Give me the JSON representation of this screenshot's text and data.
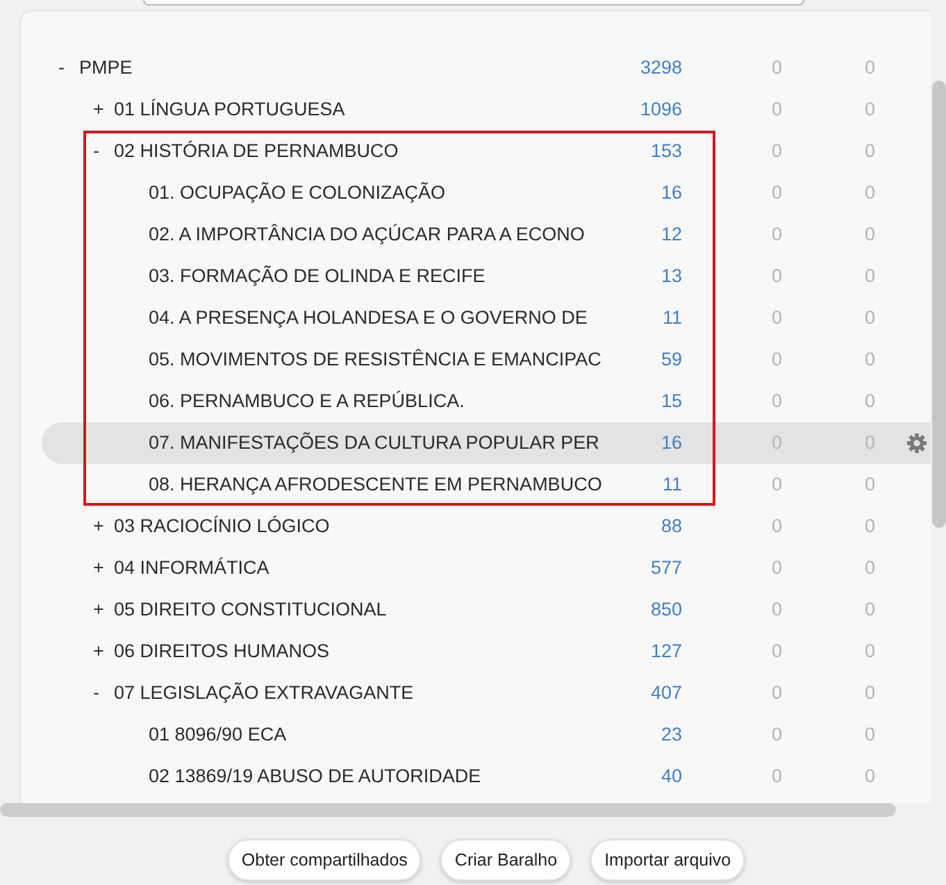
{
  "deck_tree": {
    "items": [
      {
        "toggle": "-",
        "name": "PMPE",
        "counts": [
          "3298",
          "0",
          "0"
        ],
        "selected": false,
        "highlighted": false,
        "children": [
          {
            "toggle": "+",
            "name": "01 LÍNGUA PORTUGUESA",
            "counts": [
              "1096",
              "0",
              "0"
            ],
            "selected": false,
            "highlighted": false
          },
          {
            "toggle": "-",
            "name": "02 HISTÓRIA DE PERNAMBUCO",
            "counts": [
              "153",
              "0",
              "0"
            ],
            "selected": false,
            "highlighted": true,
            "children": [
              {
                "name": "01. OCUPAÇÃO E COLONIZAÇÃO",
                "counts": [
                  "16",
                  "0",
                  "0"
                ],
                "selected": false,
                "highlighted": false
              },
              {
                "name": "02. A IMPORTÂNCIA DO AÇÚCAR PARA A ECONO",
                "counts": [
                  "12",
                  "0",
                  "0"
                ],
                "selected": false,
                "highlighted": false
              },
              {
                "name": "03. FORMAÇÃO DE OLINDA E RECIFE",
                "counts": [
                  "13",
                  "0",
                  "0"
                ],
                "selected": false,
                "highlighted": false
              },
              {
                "name": "04. A PRESENÇA HOLANDESA E O GOVERNO DE",
                "counts": [
                  "11",
                  "0",
                  "0"
                ],
                "selected": false,
                "highlighted": false
              },
              {
                "name": "05. MOVIMENTOS DE RESISTÊNCIA E EMANCIPAC",
                "counts": [
                  "59",
                  "0",
                  "0"
                ],
                "selected": false,
                "highlighted": false
              },
              {
                "name": "06. PERNAMBUCO E A REPÚBLICA.",
                "counts": [
                  "15",
                  "0",
                  "0"
                ],
                "selected": false,
                "highlighted": false
              },
              {
                "name": "07. MANIFESTAÇÕES DA CULTURA POPULAR PER",
                "counts": [
                  "16",
                  "0",
                  "0"
                ],
                "selected": true,
                "highlighted": false
              },
              {
                "name": "08. HERANÇA AFRODESCENTE EM PERNAMBUCO",
                "counts": [
                  "11",
                  "0",
                  "0"
                ],
                "selected": false,
                "highlighted": false
              }
            ]
          },
          {
            "toggle": "+",
            "name": "03 RACIOCÍNIO LÓGICO",
            "counts": [
              "88",
              "0",
              "0"
            ],
            "selected": false,
            "highlighted": false
          },
          {
            "toggle": "+",
            "name": "04 INFORMÁTICA",
            "counts": [
              "577",
              "0",
              "0"
            ],
            "selected": false,
            "highlighted": false
          },
          {
            "toggle": "+",
            "name": "05 DIREITO CONSTITUCIONAL",
            "counts": [
              "850",
              "0",
              "0"
            ],
            "selected": false,
            "highlighted": false
          },
          {
            "toggle": "+",
            "name": "06 DIREITOS HUMANOS",
            "counts": [
              "127",
              "0",
              "0"
            ],
            "selected": false,
            "highlighted": false
          },
          {
            "toggle": "-",
            "name": "07 LEGISLAÇÃO EXTRAVAGANTE",
            "counts": [
              "407",
              "0",
              "0"
            ],
            "selected": false,
            "highlighted": false,
            "children": [
              {
                "name": "01 8096/90 ECA",
                "counts": [
                  "23",
                  "0",
                  "0"
                ],
                "selected": false,
                "highlighted": false
              },
              {
                "name": "02 13869/19 ABUSO DE AUTORIDADE",
                "counts": [
                  "40",
                  "0",
                  "0"
                ],
                "selected": false,
                "highlighted": false
              }
            ]
          }
        ]
      }
    ]
  },
  "buttons": [
    "Obter compartilhados",
    "Criar Baralho",
    "Importar arquivo"
  ]
}
